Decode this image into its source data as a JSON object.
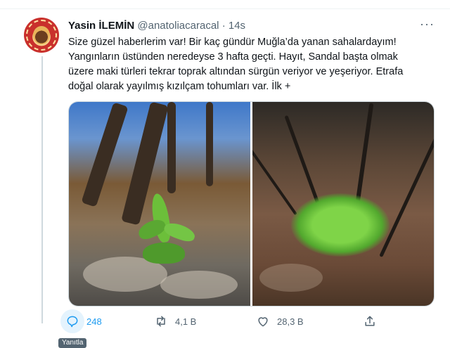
{
  "tweet": {
    "author_name": "Yasin İLEMİN",
    "author_handle": "@anatoliacaracal",
    "separator": "·",
    "time": "14s",
    "more_label": "···",
    "text_lines": [
      "Size güzel haberlerim var! Bir kaç gündür Muğla’da yanan sahalardayım!",
      "Yangınların üstünden neredeyse 3 hafta geçti. Hayıt, Sandal başta olmak",
      "üzere maki türleri tekrar toprak altından sürgün veriyor ve yeşeriyor. Etrafa",
      "doğal olarak yayılmış kızılçam tohumları var. İlk +"
    ],
    "avatar_icon": "profile-avatar-badge",
    "media": [
      {
        "icon": "photo-green-shoot-burned-forest"
      },
      {
        "icon": "photo-green-shrub-burned-ground"
      }
    ]
  },
  "actions": {
    "reply_count": "248",
    "retweet_count": "4,1 B",
    "like_count": "28,3 B",
    "reply_tooltip": "Yanıtla"
  },
  "colors": {
    "accent": "#1d9bf0",
    "secondary_text": "#536471",
    "primary_text": "#0f1419"
  }
}
